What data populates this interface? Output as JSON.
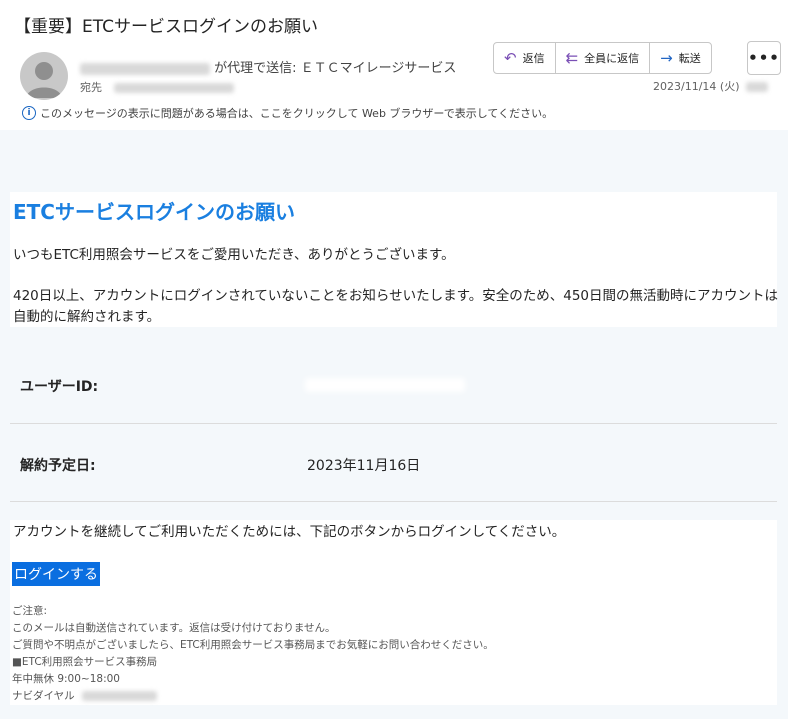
{
  "email": {
    "subject": "【重要】ETCサービスログインのお願い",
    "from_suffix": "が代理で送信: ＥＴＣマイレージサービス",
    "to_label": "宛先",
    "date": "2023/11/14 (火)",
    "info_bar": "このメッセージの表示に問題がある場合は、ここをクリックして Web ブラウザーで表示してください。"
  },
  "actions": {
    "reply": "返信",
    "reply_all": "全員に返信",
    "forward": "転送",
    "more": "•••"
  },
  "body": {
    "heading": "ETCサービスログインのお願い",
    "greeting": "いつもETC利用照会サービスをご愛用いただき、ありがとうございます。",
    "notice": "420日以上、アカウントにログインされていないことをお知らせいたします。安全のため、450日間の無活動時にアカウントは自動的に解約されます。",
    "user_id_label": "ユーザーID:",
    "cancel_date_label": "解約予定日:",
    "cancel_date_value": "2023年11月16日",
    "continue_text": "アカウントを継続してご利用いただくためには、下記のボタンからログインしてください。",
    "login_button": "ログインする",
    "notes": [
      "ご注意:",
      "このメールは自動送信されています。返信は受け付けておりません。",
      "ご質問や不明点がございましたら、ETC利用照会サービス事務局までお気軽にお問い合わせください。",
      "■ETC利用照会サービス事務局",
      "年中無休 9:00~18:00",
      "ナビダイヤル"
    ]
  }
}
